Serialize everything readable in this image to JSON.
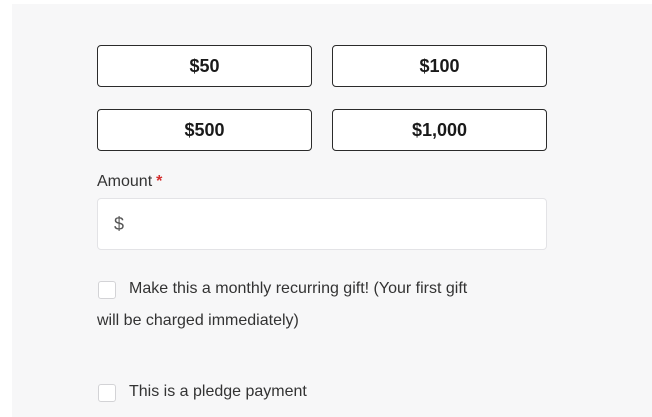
{
  "preset_amounts": [
    "$50",
    "$100",
    "$500",
    "$1,000"
  ],
  "amount_field": {
    "label": "Amount",
    "required_marker": "*",
    "currency_symbol": "$",
    "value": "",
    "placeholder": ""
  },
  "options": {
    "monthly_line1": "Make this a monthly recurring gift! (Your first gift",
    "monthly_line2": "will be charged immediately)",
    "monthly_checked": false,
    "pledge_label": "This is a pledge payment",
    "pledge_checked": false
  },
  "colors": {
    "required": "#d32f2f",
    "panel_background": "#f7f7f8"
  }
}
